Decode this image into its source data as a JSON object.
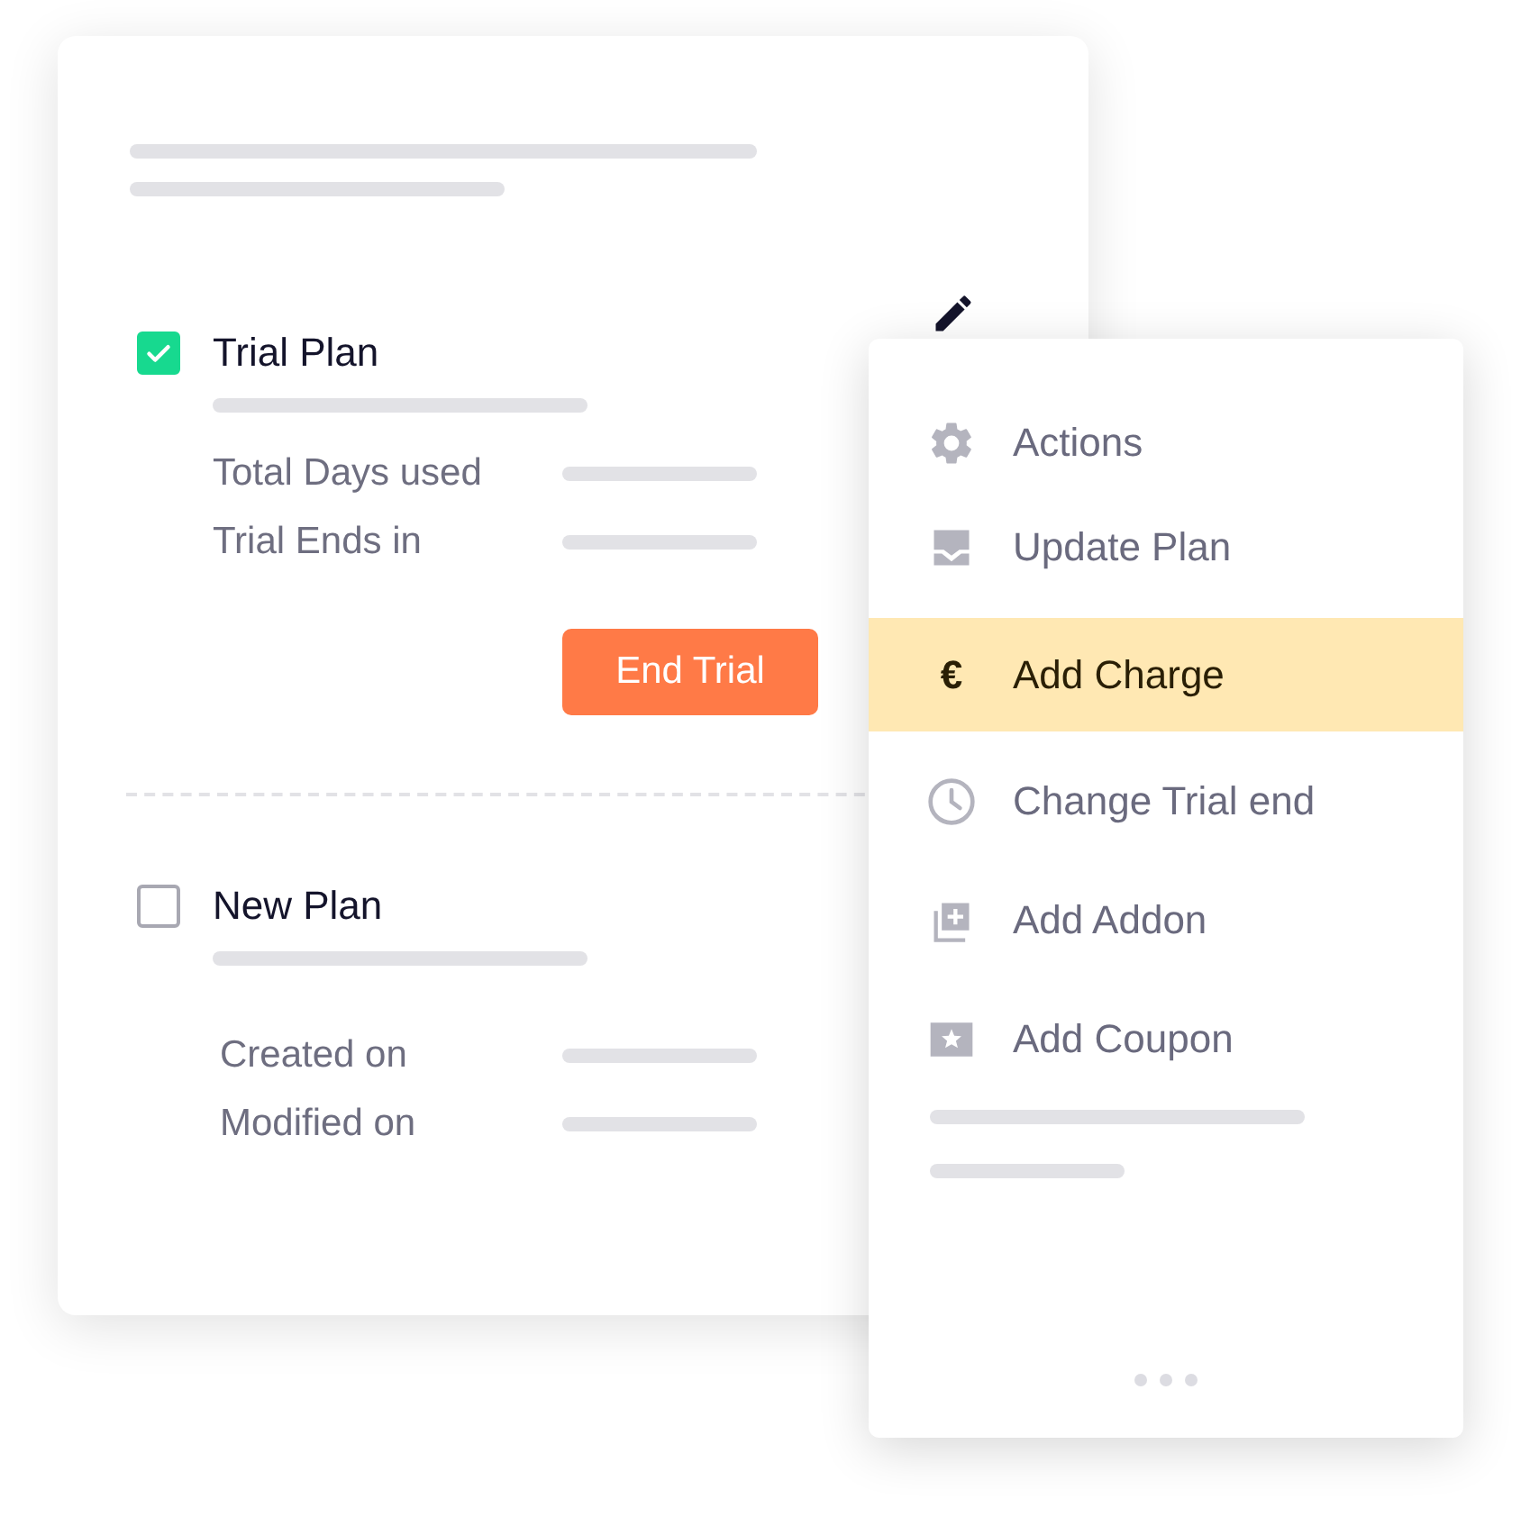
{
  "plans": [
    {
      "title": "Trial Plan",
      "checked": true,
      "details": [
        "Total Days used",
        "Trial Ends in"
      ],
      "button": "End Trial"
    },
    {
      "title": "New Plan",
      "checked": false,
      "details": [
        "Created on",
        "Modified on"
      ]
    }
  ],
  "menu": {
    "items": [
      {
        "label": "Actions",
        "selected": false
      },
      {
        "label": "Update Plan",
        "selected": false
      },
      {
        "label": "Add Charge",
        "selected": true,
        "glyph": "€"
      },
      {
        "label": "Change Trial end",
        "selected": false
      },
      {
        "label": "Add Addon",
        "selected": false
      },
      {
        "label": "Add Coupon",
        "selected": false
      }
    ]
  }
}
